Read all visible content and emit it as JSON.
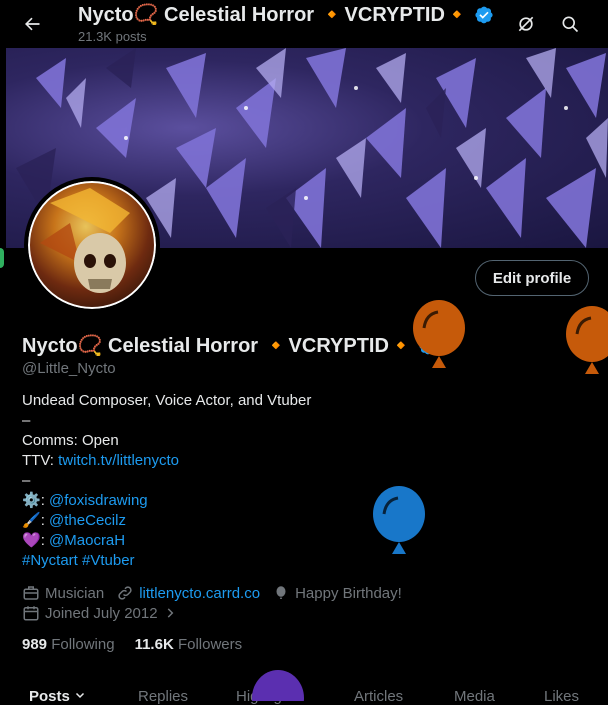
{
  "header": {
    "title": "Nycto📿 Celestial Horror 🔸VCRYPTID🔸",
    "posts_count": "21.3K posts"
  },
  "profile": {
    "display_name": "Nycto📿 Celestial Horror 🔸VCRYPTID🔸",
    "handle": "@Little_Nycto",
    "edit_label": "Edit profile",
    "bio": {
      "line1": "Undead Composer, Voice Actor, and Vtuber",
      "dash1": "–",
      "comms": "Comms: Open",
      "ttv_label": "TTV: ",
      "ttv_link": "twitch.tv/littlenycto",
      "dash2": "–",
      "credit1_icon": "⚙️",
      "credit1_sep": ": ",
      "credit1": "@foxisdrawing",
      "credit2_icon": "🖌️",
      "credit2_sep": ": ",
      "credit2": "@theCecilz",
      "credit3_icon": "💜",
      "credit3_sep": ": ",
      "credit3": "@MaocraH",
      "hashtags": "#Nyctart #Vtuber"
    },
    "meta": {
      "profession": "Musician",
      "website": "littlenycto.carrd.co",
      "birthday": "Happy Birthday!",
      "joined": "Joined July 2012"
    },
    "following_count": "989",
    "following_label": "Following",
    "followers_count": "11.6K",
    "followers_label": "Followers"
  },
  "tabs": [
    "Posts",
    "Replies",
    "Highlights",
    "Articles",
    "Media",
    "Likes"
  ],
  "colors": {
    "accent": "#1d9bf0",
    "balloon_orange": "#c65a0a",
    "balloon_blue": "#1877c9",
    "balloon_purple": "#5b2fb0"
  }
}
